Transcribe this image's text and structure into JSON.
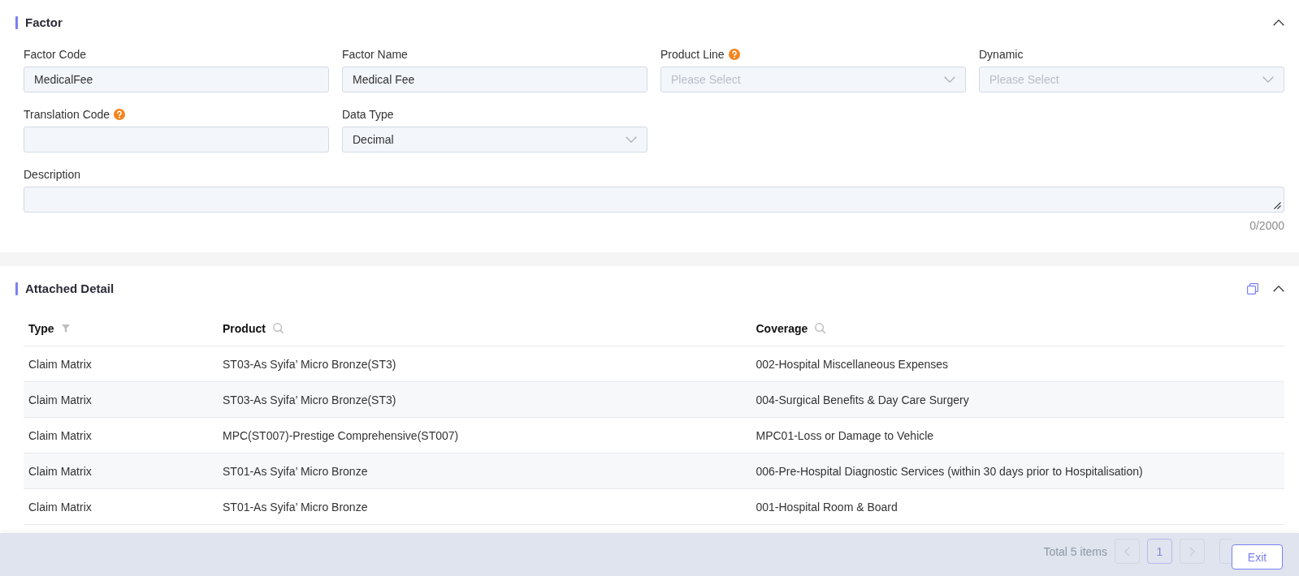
{
  "form_section": {
    "title": "Factor",
    "expanded": true,
    "fields": [
      {
        "kind": "input",
        "label": "Factor Code",
        "help": false,
        "value": "MedicalFee"
      },
      {
        "kind": "input",
        "label": "Factor Name",
        "help": false,
        "value": "Medical Fee"
      },
      {
        "kind": "select",
        "label": "Product Line",
        "help": true,
        "placeholder": "Please Select"
      },
      {
        "kind": "select",
        "label": "Dynamic",
        "help": false,
        "placeholder": "Please Select"
      },
      {
        "kind": "input",
        "label": "Translation Code",
        "help": true
      },
      {
        "kind": "select",
        "label": "Data Type",
        "help": false,
        "value": "Decimal"
      },
      {
        "kind": "textarea",
        "label": "Description",
        "help": false,
        "counter": "0/2000"
      }
    ]
  },
  "detail_section": {
    "title": "Attached Detail",
    "expanded": true,
    "table": {
      "columns": [
        {
          "label": "Type",
          "kind": "filter"
        },
        {
          "label": "Product",
          "kind": "search"
        },
        {
          "label": "Coverage",
          "kind": "search"
        }
      ],
      "rows": [
        [
          "Claim Matrix",
          "ST03-As Syifa’ Micro Bronze(ST3)",
          "002-Hospital Miscellaneous Expenses"
        ],
        [
          "Claim Matrix",
          "ST03-As Syifa’ Micro Bronze(ST3)",
          "004-Surgical Benefits & Day Care Surgery"
        ],
        [
          "Claim Matrix",
          "MPC(ST007)-Prestige Comprehensive(ST007)",
          "MPC01-Loss or Damage to Vehicle"
        ],
        [
          "Claim Matrix",
          "ST01-As Syifa’ Micro Bronze",
          "006-Pre-Hospital Diagnostic Services (within 30 days prior to Hospitalisation)"
        ],
        [
          "Claim Matrix",
          "ST01-As Syifa’ Micro Bronze",
          "001-Hospital Room & Board"
        ]
      ]
    }
  },
  "pagination": {
    "total": "Total 5 items",
    "prev": {
      "disabled": true
    },
    "pages": [
      {
        "label": "1",
        "selected": true
      }
    ],
    "next": {
      "disabled": true
    }
  },
  "footer": {
    "buttons": [
      "Exit"
    ]
  }
}
